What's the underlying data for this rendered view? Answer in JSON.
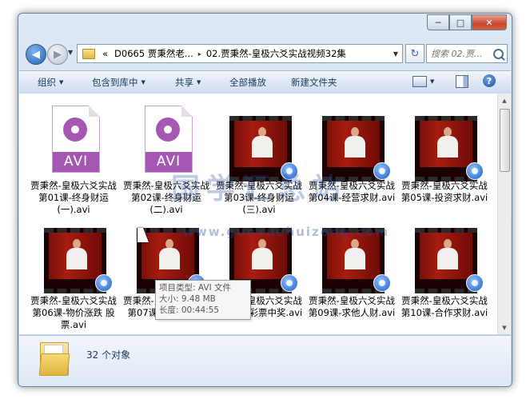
{
  "window": {
    "caption_minimize": "─",
    "caption_maximize": "□",
    "caption_close": "✕"
  },
  "nav": {
    "breadcrumb_root": "«",
    "breadcrumb_1": "D0665 贾秉然老...",
    "breadcrumb_sep": "▸",
    "breadcrumb_2": "02.贾秉然-皇极六爻实战视频32集",
    "search_placeholder": "搜索 02.贾...",
    "refresh_glyph": "↻"
  },
  "toolbar": {
    "organize": "组织",
    "include_in_library": "包含到库中",
    "share": "共享",
    "play_all": "全部播放",
    "new_folder": "新建文件夹",
    "help": "?"
  },
  "files": [
    {
      "label": "贾秉然-皇极六爻实战第01课-终身财运(一).avi",
      "kind": "generic",
      "badge": "AVI"
    },
    {
      "label": "贾秉然-皇极六爻实战第02课-终身财运(二).avi",
      "kind": "generic",
      "badge": "AVI"
    },
    {
      "label": "贾秉然-皇极六爻实战第03课-终身财运(三).avi",
      "kind": "video"
    },
    {
      "label": "贾秉然-皇极六爻实战第04课-经营求财.avi",
      "kind": "video"
    },
    {
      "label": "贾秉然-皇极六爻实战第05课-投资求财.avi",
      "kind": "video"
    },
    {
      "label": "贾秉然-皇极六爻实战第06课-物价涨跌 股票.avi",
      "kind": "video"
    },
    {
      "label": "贾秉然-皇极六爻实战第07课-借求财.avi",
      "kind": "video"
    },
    {
      "label": "贾秉然-皇极六爻实战第08课-彩票中奖.avi",
      "kind": "video"
    },
    {
      "label": "贾秉然-皇极六爻实战第09课-求他人财.avi",
      "kind": "video"
    },
    {
      "label": "贾秉然-皇极六爻实战第10课-合作求财.avi",
      "kind": "video"
    }
  ],
  "tooltip": {
    "line1": "项目类型: AVI 文件",
    "line2": "大小: 9.48 MB",
    "line3": "长度: 00:44:55"
  },
  "watermark": {
    "text": "国学汇总站",
    "url": "www.guoxuehuizong.com"
  },
  "status": {
    "count": "32 个对象"
  }
}
